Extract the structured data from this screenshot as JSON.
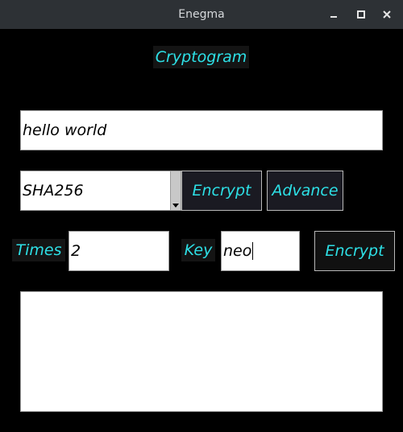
{
  "window": {
    "title": "Enegma",
    "controls": [
      "minimize-icon",
      "maximize-icon",
      "close-icon"
    ]
  },
  "heading": "Cryptogram",
  "message_input": {
    "value": "hello world"
  },
  "algorithm_select": {
    "selected": "SHA256"
  },
  "buttons": {
    "encrypt": "Encrypt",
    "advance": "Advance",
    "encrypt_with_key": "Encrypt"
  },
  "times": {
    "label": "Times",
    "value": "2"
  },
  "key": {
    "label": "Key",
    "value": "neo"
  },
  "output": {
    "value": ""
  },
  "colors": {
    "titlebar": "#2d3135",
    "background": "#000000",
    "accent_text": "#2de0e6",
    "button_bg": "#1a1a22"
  }
}
